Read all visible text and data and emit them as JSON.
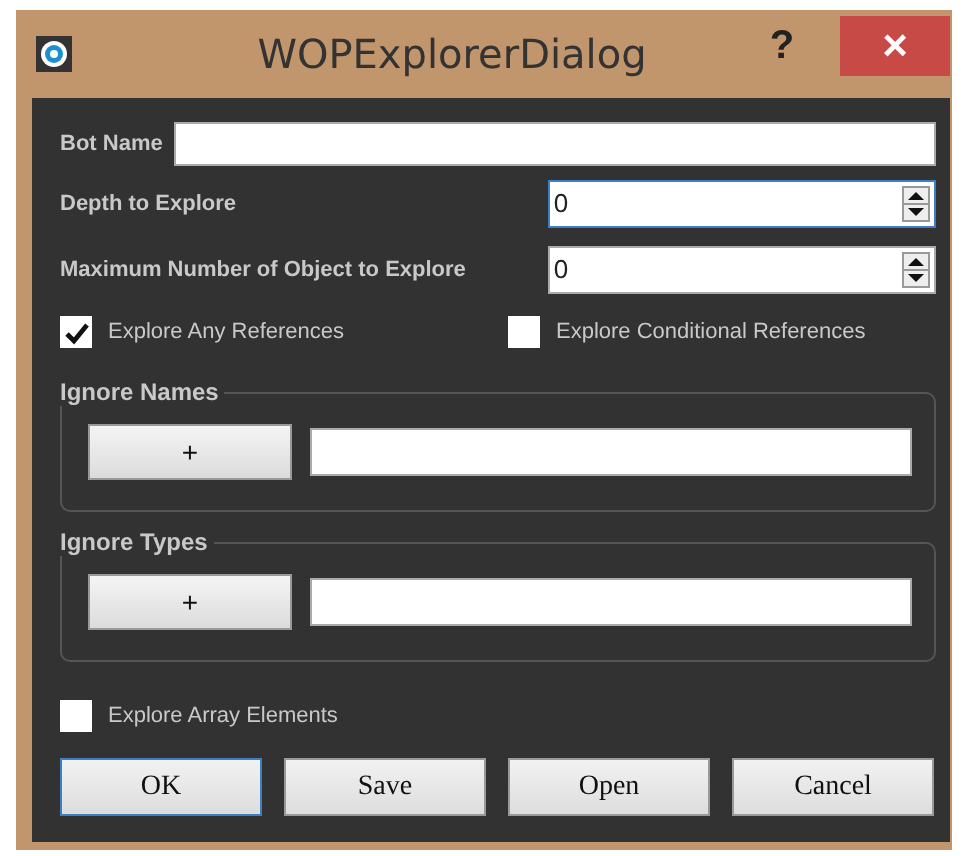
{
  "window": {
    "title": "WOPExplorerDialog",
    "help": "?",
    "close": "×"
  },
  "fields": [
    {
      "label": "Bot Name",
      "kind": "text",
      "focused": false
    },
    {
      "label": "Depth to Explore",
      "value": "0",
      "kind": "spinner",
      "focused": true
    },
    {
      "label": "Maximum Number of Object to Explore",
      "value": "0",
      "kind": "spinner",
      "focused": false
    }
  ],
  "reference_options": [
    {
      "label": "Explore Any References",
      "checked": true
    },
    {
      "label": "Explore Conditional References",
      "checked": false
    }
  ],
  "groups": [
    {
      "title": "Ignore Names",
      "add_button": "+"
    },
    {
      "title": "Ignore Types",
      "add_button": "+"
    }
  ],
  "array_option": {
    "label": "Explore Array Elements",
    "checked": false
  },
  "buttons": [
    {
      "label": "OK",
      "default": true
    },
    {
      "label": "Save",
      "default": false
    },
    {
      "label": "Open",
      "default": false
    },
    {
      "label": "Cancel",
      "default": false
    }
  ]
}
